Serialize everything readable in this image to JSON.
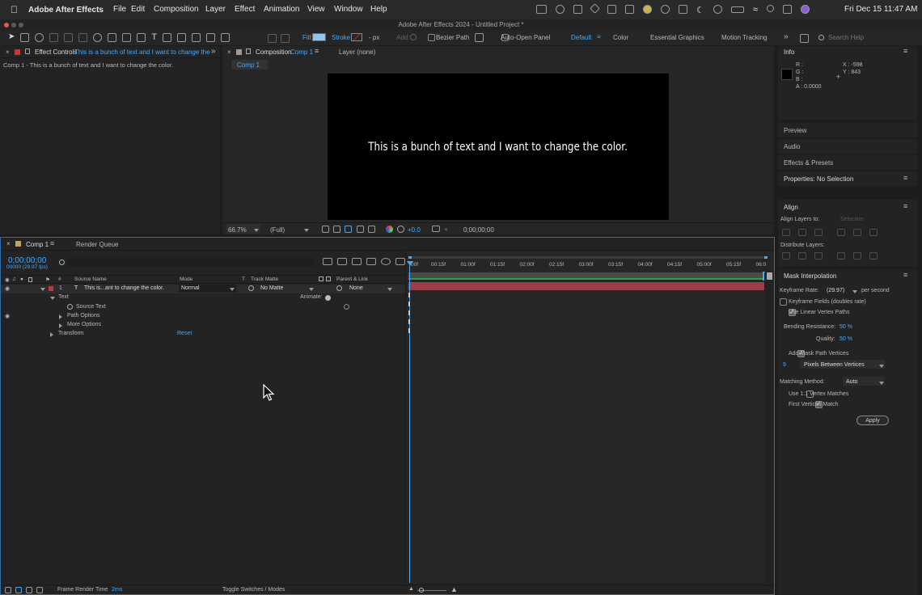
{
  "menubar": {
    "app_name": "Adobe After Effects",
    "items": [
      "File",
      "Edit",
      "Composition",
      "Layer",
      "Effect",
      "Animation",
      "View",
      "Window",
      "Help"
    ],
    "clock": "Fri Dec 15  11:47 AM"
  },
  "window": {
    "title": "Adobe After Effects 2024 - Untitled Project *"
  },
  "toolbar": {
    "fill_label": "Fill:",
    "stroke_label": "Stroke:",
    "stroke_width": "- px",
    "add_label": "Add:",
    "bezier_label": "Bezier Path",
    "auto_open_label": "Auto-Open Panel",
    "workspaces": [
      "Default",
      "Color",
      "Essential Graphics",
      "Motion Tracking"
    ],
    "search_placeholder": "Search Help"
  },
  "effect_controls": {
    "tab_label": "Effect Controls",
    "tab_layer": "This is a bunch of text and I want to change the",
    "breadcrumb": "Comp 1 - This is a bunch of text and I want to change the color."
  },
  "composition": {
    "tab_label": "Composition",
    "tab_comp": "Comp 1",
    "layer_tab": "Layer (none)",
    "sub_tab": "Comp 1",
    "canvas_text": "This is a bunch of text and I want to change the color.",
    "zoom": "66.7%",
    "resolution": "(Full)",
    "exposure": "+0.0",
    "timecode": "0;00;00;00"
  },
  "timeline": {
    "tab_label": "Comp 1",
    "render_queue": "Render Queue",
    "timecode": "0;00;00;00",
    "fps": "00000 (29.97 fps)",
    "headers": {
      "num": "#",
      "source": "Source Name",
      "mode": "Mode",
      "t": "T",
      "matte": "Track Matte",
      "parent": "Parent & Link"
    },
    "layer": {
      "num": "1",
      "name": "This is...ant to change the color.",
      "mode": "Normal",
      "matte": "No Matte",
      "parent": "None"
    },
    "props": {
      "text": "Text",
      "animate": "Animate:",
      "source_text": "Source Text",
      "path_options": "Path Options",
      "more_options": "More Options",
      "transform": "Transform",
      "reset": "Reset"
    },
    "ruler": [
      "00f",
      "00:15f",
      "01:00f",
      "01:15f",
      "02:00f",
      "02:15f",
      "03:00f",
      "03:15f",
      "04:00f",
      "04:15f",
      "05:00f",
      "05:15f",
      "06:0"
    ],
    "footer": {
      "render_label": "Frame Render Time",
      "render_value": "2ms",
      "toggle": "Toggle Switches / Modes"
    }
  },
  "info": {
    "title": "Info",
    "r": "R :",
    "g": "G :",
    "b": "B :",
    "a": "A : 0.0000",
    "x": "X : -598",
    "y": "Y : 843"
  },
  "side_panels": [
    "Preview",
    "Audio",
    "Effects & Presets"
  ],
  "properties": {
    "title": "Properties: No Selection"
  },
  "align": {
    "title": "Align",
    "align_to_label": "Align Layers to:",
    "align_to_value": "Selection",
    "distribute_label": "Distribute Layers:"
  },
  "mask": {
    "title": "Mask Interpolation",
    "rate_label": "Keyframe Rate:",
    "rate_value": "(29.97)",
    "rate_unit": "per second",
    "fields_label": "Keyframe Fields (doubles rate)",
    "fields_checked": false,
    "linear_label": "Use Linear Vertex Paths",
    "linear_checked": true,
    "bend_label": "Bending Resistance:",
    "bend_value": "50 %",
    "quality_label": "Quality:",
    "quality_value": "50 %",
    "add_vertices_label": "Add Mask Path Vertices",
    "add_vertices_checked": true,
    "vertices_value": "9",
    "vertices_mode": "Pixels Between Vertices",
    "matching_label": "Matching Method:",
    "matching_value": "Auto",
    "one_to_one_label": "Use 1:1 Vertex Matches",
    "one_to_one_checked": false,
    "first_match_label": "First Vertices Match",
    "first_match_checked": true,
    "apply_label": "Apply"
  },
  "colors": {
    "accent": "#4aa8f5",
    "layer_label_red": "#c0383a",
    "layer_bar": "#9a3e45",
    "work_area_green": "#2f9e3f"
  }
}
